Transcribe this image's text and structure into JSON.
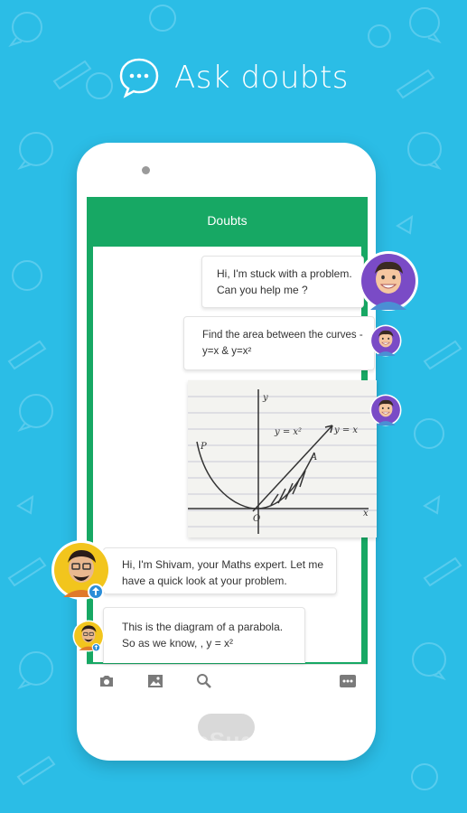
{
  "promo": {
    "headline": "Ask doubts"
  },
  "app": {
    "title": "Doubts"
  },
  "messages": [
    {
      "sender": "user",
      "lines": [
        "Hi, I'm stuck with a problem.",
        "Can you help me ?"
      ]
    },
    {
      "sender": "user",
      "lines": [
        "Find the area between the curves -",
        "y=x & y=x²"
      ]
    },
    {
      "sender": "user",
      "type": "image",
      "image_labels": [
        "y",
        "y = x²",
        "y = x",
        "A",
        "P",
        "O",
        "x"
      ]
    },
    {
      "sender": "expert",
      "lines": [
        "Hi, I'm Shivam, your Maths expert. Let me",
        "have a quick look at your problem."
      ]
    },
    {
      "sender": "expert",
      "lines": [
        "This is the diagram of a parabola.",
        "So as we know, , y = x²"
      ]
    }
  ],
  "toolbar": {
    "icons": [
      "camera-icon",
      "gallery-icon",
      "search-icon",
      "more-icon"
    ]
  },
  "watermark": {
    "brand": "SoftwareSuggest",
    "suffix": ".com"
  },
  "colors": {
    "background": "#2bbde6",
    "appbar": "#17a864",
    "user_avatar_bg": "#7a4bc6",
    "expert_avatar_bg": "#f2c51d"
  }
}
